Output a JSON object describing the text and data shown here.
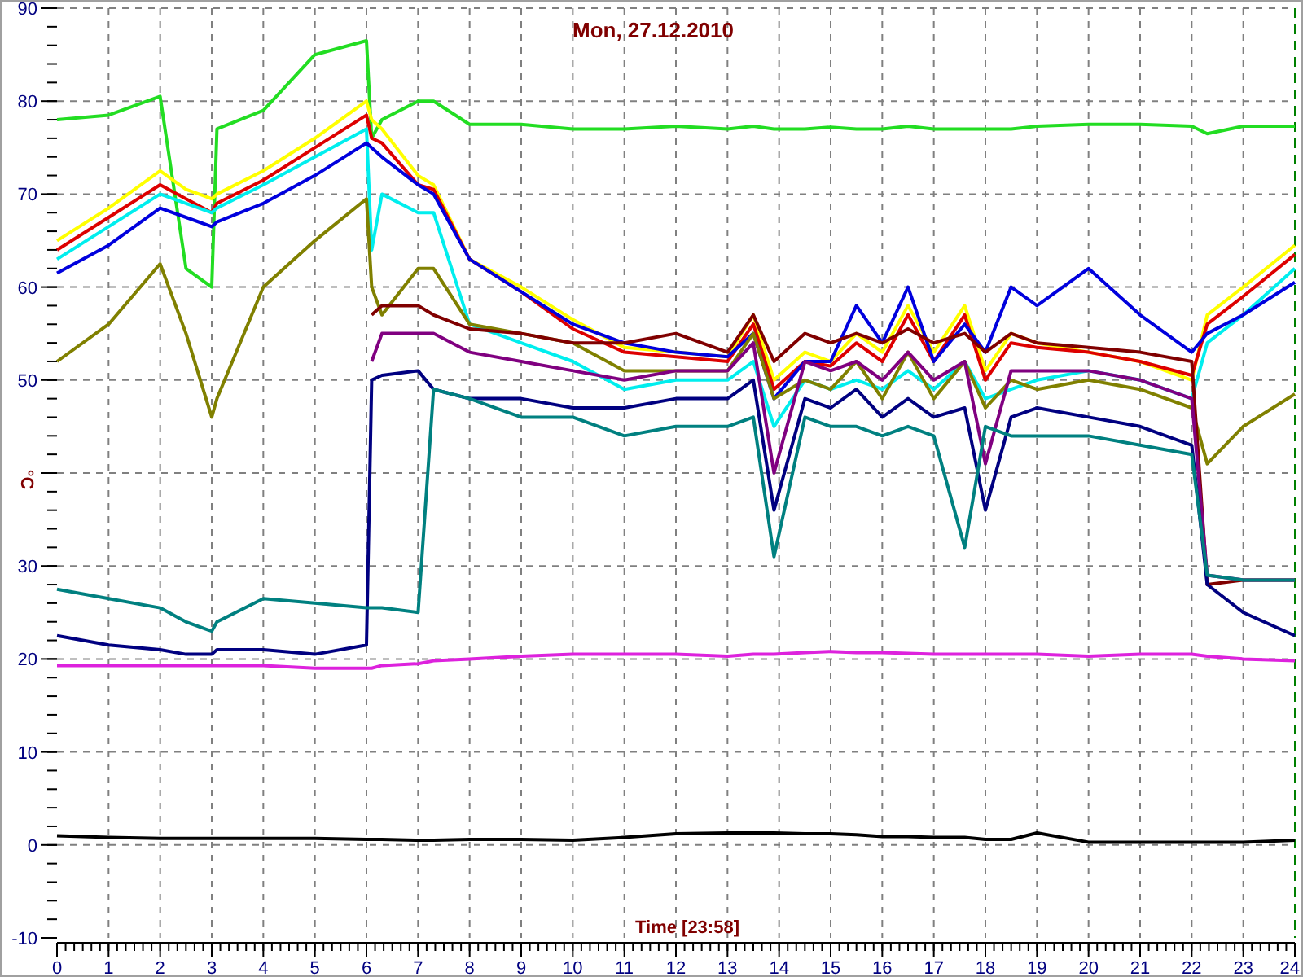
{
  "chart": {
    "chart_data": {
      "type": "line",
      "title": "Mon, 27.12.2010",
      "xlabel": "Time [23:58]",
      "ylabel": "°C",
      "x": [
        0,
        1,
        2,
        2.5,
        3,
        3.1,
        4,
        5,
        6,
        6.1,
        6.3,
        7,
        7.3,
        8,
        9,
        10,
        11,
        12,
        13,
        13.5,
        13.9,
        14.5,
        15,
        15.5,
        16,
        16.5,
        17,
        17.6,
        18,
        18.5,
        19,
        20,
        21,
        22,
        22.3,
        23,
        24
      ],
      "xlim": [
        0,
        24
      ],
      "ylim": [
        -10,
        90
      ],
      "xticks": [
        0,
        1,
        2,
        3,
        4,
        5,
        6,
        7,
        8,
        9,
        10,
        11,
        12,
        13,
        14,
        15,
        16,
        17,
        18,
        19,
        20,
        21,
        22,
        23,
        24
      ],
      "yticks": [
        -10,
        0,
        10,
        20,
        30,
        50,
        60,
        70,
        80,
        90
      ],
      "grid": true,
      "series": [
        {
          "color": "#22dd22",
          "values": [
            78,
            78.5,
            80.5,
            62,
            60,
            77,
            79,
            85,
            86.5,
            76,
            78,
            80,
            80,
            77.5,
            77.5,
            77,
            77,
            77.3,
            77,
            77.3,
            77,
            77,
            77.2,
            77,
            77,
            77.3,
            77,
            77,
            77,
            77,
            77.3,
            77.5,
            77.5,
            77.3,
            76.5,
            77.3,
            77.3
          ]
        },
        {
          "color": "#ffff00",
          "values": [
            65,
            68.5,
            72.5,
            70.5,
            69.5,
            70,
            72.5,
            76,
            80,
            78,
            77,
            72,
            71,
            63,
            60,
            56.5,
            53.5,
            53,
            52.5,
            57,
            50,
            53,
            52,
            55,
            53,
            58,
            53,
            58,
            51,
            55,
            54,
            53,
            52,
            50,
            57,
            60,
            64.5
          ]
        },
        {
          "color": "#dd0000",
          "values": [
            64,
            67.5,
            71,
            69.5,
            68,
            69,
            71.5,
            75,
            78.5,
            76,
            75.5,
            71,
            70.5,
            63,
            59.5,
            55.5,
            53,
            52.5,
            52,
            56,
            49,
            52,
            51.5,
            54,
            52,
            57,
            52,
            57,
            50,
            54,
            53.5,
            53,
            52,
            50.5,
            56,
            59,
            63.5
          ]
        },
        {
          "color": "#00eeee",
          "values": [
            63,
            66.5,
            70,
            69,
            68,
            68.5,
            71,
            74,
            77,
            64,
            70,
            68,
            68,
            56,
            54,
            52,
            49,
            50,
            50,
            52,
            45,
            50,
            49,
            50,
            49,
            51,
            49,
            52,
            48,
            49,
            50,
            51,
            50,
            48,
            54,
            57,
            62
          ]
        },
        {
          "color": "#0000dd",
          "values": [
            61.5,
            64.5,
            68.5,
            67.5,
            66.5,
            67,
            69,
            72,
            75.5,
            75,
            74,
            71,
            70,
            63,
            59.5,
            56,
            54,
            53,
            52.5,
            55,
            48,
            52,
            52,
            58,
            54,
            60,
            52,
            56,
            53,
            60,
            58,
            62,
            57,
            53,
            55,
            57,
            60.5
          ]
        },
        {
          "color": "#808000",
          "values": [
            52,
            56,
            62.5,
            55,
            46,
            48,
            60,
            65,
            69.5,
            60,
            57,
            62,
            62,
            56,
            55,
            54,
            51,
            51,
            51,
            55,
            48,
            50,
            49,
            52,
            48,
            53,
            48,
            52,
            47,
            50,
            49,
            50,
            49,
            47,
            41,
            45,
            48.5
          ]
        },
        {
          "color": "#800000",
          "values": [
            null,
            null,
            null,
            null,
            null,
            null,
            null,
            null,
            null,
            57,
            58,
            58,
            57,
            55.5,
            55,
            54,
            54,
            55,
            53,
            57,
            52,
            55,
            54,
            55,
            54,
            55.5,
            54,
            55,
            53,
            55,
            54,
            53.5,
            53,
            52,
            28,
            28.5,
            28.5
          ]
        },
        {
          "color": "#800080",
          "values": [
            null,
            null,
            null,
            null,
            null,
            null,
            null,
            null,
            null,
            52,
            55,
            55,
            55,
            53,
            52,
            51,
            50,
            51,
            51,
            54,
            40,
            52,
            51,
            52,
            50,
            53,
            50,
            52,
            41,
            51,
            51,
            51,
            50,
            48,
            29,
            28.5,
            28.5
          ]
        },
        {
          "color": "#000080",
          "values": [
            22.5,
            21.5,
            21,
            20.5,
            20.5,
            21,
            21,
            20.5,
            21.5,
            50,
            50.5,
            51,
            49,
            48,
            48,
            47,
            47,
            48,
            48,
            50,
            36,
            48,
            47,
            49,
            46,
            48,
            46,
            47,
            36,
            46,
            47,
            46,
            45,
            43,
            28,
            25,
            22.5
          ]
        },
        {
          "color": "#008080",
          "values": [
            27.5,
            26.5,
            25.5,
            24,
            23,
            24,
            26.5,
            26,
            25.5,
            25.5,
            25.5,
            25,
            49,
            48,
            46,
            46,
            44,
            45,
            45,
            46,
            31,
            46,
            45,
            45,
            44,
            45,
            44,
            32,
            45,
            44,
            44,
            44,
            43,
            42,
            29,
            28.5,
            28.5
          ]
        },
        {
          "color": "#dd22dd",
          "values": [
            19.3,
            19.3,
            19.3,
            19.3,
            19.3,
            19.3,
            19.3,
            19,
            19,
            19,
            19.3,
            19.5,
            19.8,
            20,
            20.3,
            20.5,
            20.5,
            20.5,
            20.3,
            20.5,
            20.5,
            20.7,
            20.8,
            20.7,
            20.7,
            20.6,
            20.5,
            20.5,
            20.5,
            20.5,
            20.5,
            20.3,
            20.5,
            20.5,
            20.3,
            20,
            19.8
          ]
        },
        {
          "color": "#000000",
          "values": [
            1,
            0.8,
            0.7,
            0.7,
            0.7,
            0.7,
            0.7,
            0.7,
            0.6,
            0.6,
            0.6,
            0.5,
            0.5,
            0.6,
            0.6,
            0.5,
            0.8,
            1.2,
            1.3,
            1.3,
            1.3,
            1.2,
            1.2,
            1.1,
            0.9,
            0.9,
            0.8,
            0.8,
            0.6,
            0.6,
            1.3,
            0.3,
            0.3,
            0.3,
            0.3,
            0.3,
            0.5
          ]
        }
      ]
    }
  }
}
